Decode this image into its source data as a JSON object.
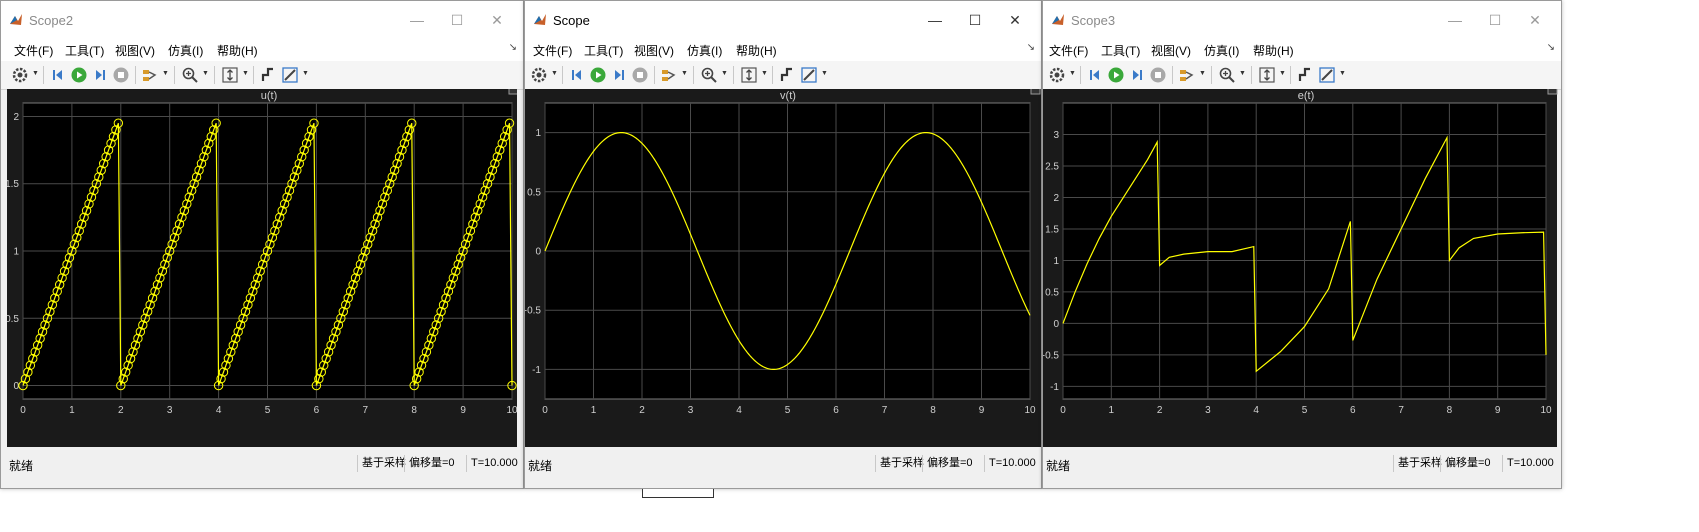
{
  "windows": [
    {
      "id": "scope2",
      "title": "Scope2",
      "active": false,
      "menu": [
        "文件(F)",
        "工具(T)",
        "视图(V)",
        "仿真(I)",
        "帮助(H)"
      ],
      "plot_title": "u(t)",
      "status": {
        "left": "就绪",
        "sampling": "基于采样",
        "offset": "偏移量=0",
        "time": "T=10.000"
      },
      "chart_data": {
        "type": "line",
        "title": "u(t)",
        "xlim": [
          0,
          10
        ],
        "ylim": [
          -0.1,
          2.1
        ],
        "xticks": [
          0,
          1,
          2,
          3,
          4,
          5,
          6,
          7,
          8,
          9,
          10
        ],
        "yticks": [
          0,
          0.5,
          1,
          1.5,
          2
        ],
        "ytick_labels": [
          "0",
          "0.5",
          "1",
          "1.5",
          "2"
        ],
        "grid": true,
        "line_color": "#ffff00",
        "markers": "circle",
        "series": [
          {
            "kind": "sawtooth",
            "period": 2,
            "peak": 1.95,
            "sample_step": 0.05
          }
        ]
      }
    },
    {
      "id": "scope",
      "title": "Scope",
      "active": true,
      "menu": [
        "文件(F)",
        "工具(T)",
        "视图(V)",
        "仿真(I)",
        "帮助(H)"
      ],
      "plot_title": "v(t)",
      "status": {
        "left": "就绪",
        "sampling": "基于采样",
        "offset": "偏移量=0",
        "time": "T=10.000"
      },
      "chart_data": {
        "type": "line",
        "title": "v(t)",
        "xlim": [
          0,
          10
        ],
        "ylim": [
          -1.25,
          1.25
        ],
        "xticks": [
          0,
          1,
          2,
          3,
          4,
          5,
          6,
          7,
          8,
          9,
          10
        ],
        "yticks": [
          -1,
          -0.5,
          0,
          0.5,
          1
        ],
        "ytick_labels": [
          "-1",
          "-0.5",
          "0",
          "0.5",
          "1"
        ],
        "grid": true,
        "line_color": "#ffff00",
        "series": [
          {
            "kind": "sine",
            "amplitude": 1,
            "frequency": 1
          }
        ]
      }
    },
    {
      "id": "scope3",
      "title": "Scope3",
      "active": false,
      "menu": [
        "文件(F)",
        "工具(T)",
        "视图(V)",
        "仿真(I)",
        "帮助(H)"
      ],
      "plot_title": "e(t)",
      "status": {
        "left": "就绪",
        "sampling": "基于采样",
        "offset": "偏移量=0",
        "time": "T=10.000"
      },
      "chart_data": {
        "type": "line",
        "title": "e(t)",
        "xlim": [
          0,
          10
        ],
        "ylim": [
          -1.2,
          3.5
        ],
        "xticks": [
          0,
          1,
          2,
          3,
          4,
          5,
          6,
          7,
          8,
          9,
          10
        ],
        "yticks": [
          -1,
          -0.5,
          0,
          0.5,
          1,
          1.5,
          2,
          2.5,
          3
        ],
        "ytick_labels": [
          "-1",
          "-0.5",
          "0",
          "0.5",
          "1",
          "1.5",
          "2",
          "2.5",
          "3"
        ],
        "grid": true,
        "line_color": "#ffff00",
        "series": [
          {
            "kind": "points",
            "points": [
              [
                0,
                0
              ],
              [
                0.25,
                0.5
              ],
              [
                0.5,
                0.95
              ],
              [
                0.75,
                1.35
              ],
              [
                1.0,
                1.7
              ],
              [
                1.25,
                2.0
              ],
              [
                1.5,
                2.3
              ],
              [
                1.75,
                2.6
              ],
              [
                1.95,
                2.88
              ],
              [
                2.0,
                0.92
              ],
              [
                2.2,
                1.05
              ],
              [
                2.5,
                1.1
              ],
              [
                3.0,
                1.14
              ],
              [
                3.5,
                1.14
              ],
              [
                3.95,
                1.22
              ],
              [
                4.0,
                -0.76
              ],
              [
                4.5,
                -0.45
              ],
              [
                5.0,
                -0.05
              ],
              [
                5.5,
                0.55
              ],
              [
                5.95,
                1.62
              ],
              [
                6.0,
                -0.27
              ],
              [
                6.5,
                0.7
              ],
              [
                7.0,
                1.5
              ],
              [
                7.5,
                2.3
              ],
              [
                7.95,
                2.95
              ],
              [
                8.0,
                1.0
              ],
              [
                8.2,
                1.2
              ],
              [
                8.5,
                1.35
              ],
              [
                9.0,
                1.42
              ],
              [
                9.5,
                1.44
              ],
              [
                9.95,
                1.45
              ],
              [
                10.0,
                -0.5
              ]
            ]
          }
        ]
      }
    }
  ],
  "xtick_labels": [
    "0",
    "1",
    "2",
    "3",
    "4",
    "5",
    "6",
    "7",
    "8",
    "9",
    "10"
  ]
}
